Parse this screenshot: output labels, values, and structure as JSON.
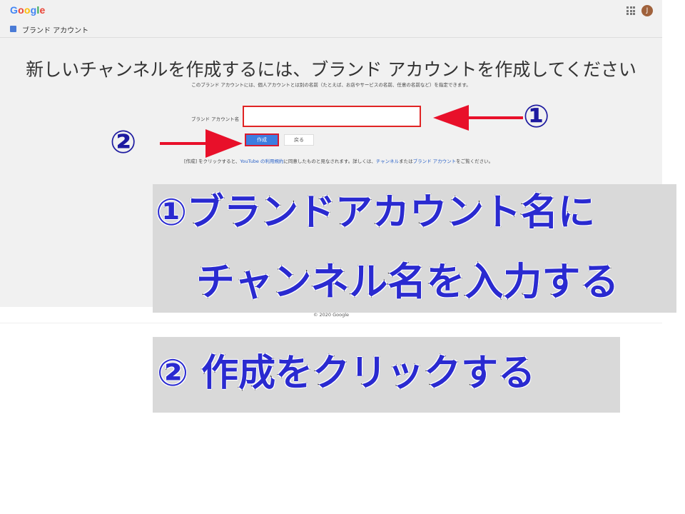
{
  "header": {
    "logo": "Google",
    "avatar_initial": "J"
  },
  "subheader": {
    "label": "ブランド アカウント"
  },
  "main": {
    "title": "新しいチャンネルを作成するには、ブランド アカウントを作成してください",
    "description": "このブランド アカウントには、個人アカウントとは別の名前（たとえば、お店やサービスの名前、任意の名前など）を指定できます。",
    "field_label": "ブランド アカウント名",
    "input_value": "",
    "create_label": "作成",
    "back_label": "戻る",
    "note_prefix": "[作成] をクリックすると、",
    "note_link1": "YouTube の利用規約",
    "note_middle": "に同意したものと見なされます。詳しくは、",
    "note_link2": "チャンネル",
    "note_and": "または",
    "note_link3": "ブランド アカウント",
    "note_suffix": "をご覧ください。"
  },
  "footer": {
    "copyright": "© 2020 Google"
  },
  "annotations": {
    "marker1": "①",
    "marker2": "②",
    "callout1_line1": "①ブランドアカウント名に",
    "callout1_line2": "チャンネル名を入力する",
    "callout2": "② 作成をクリックする",
    "arrow_color": "#e8102a",
    "text_color": "#2a2ad0"
  }
}
